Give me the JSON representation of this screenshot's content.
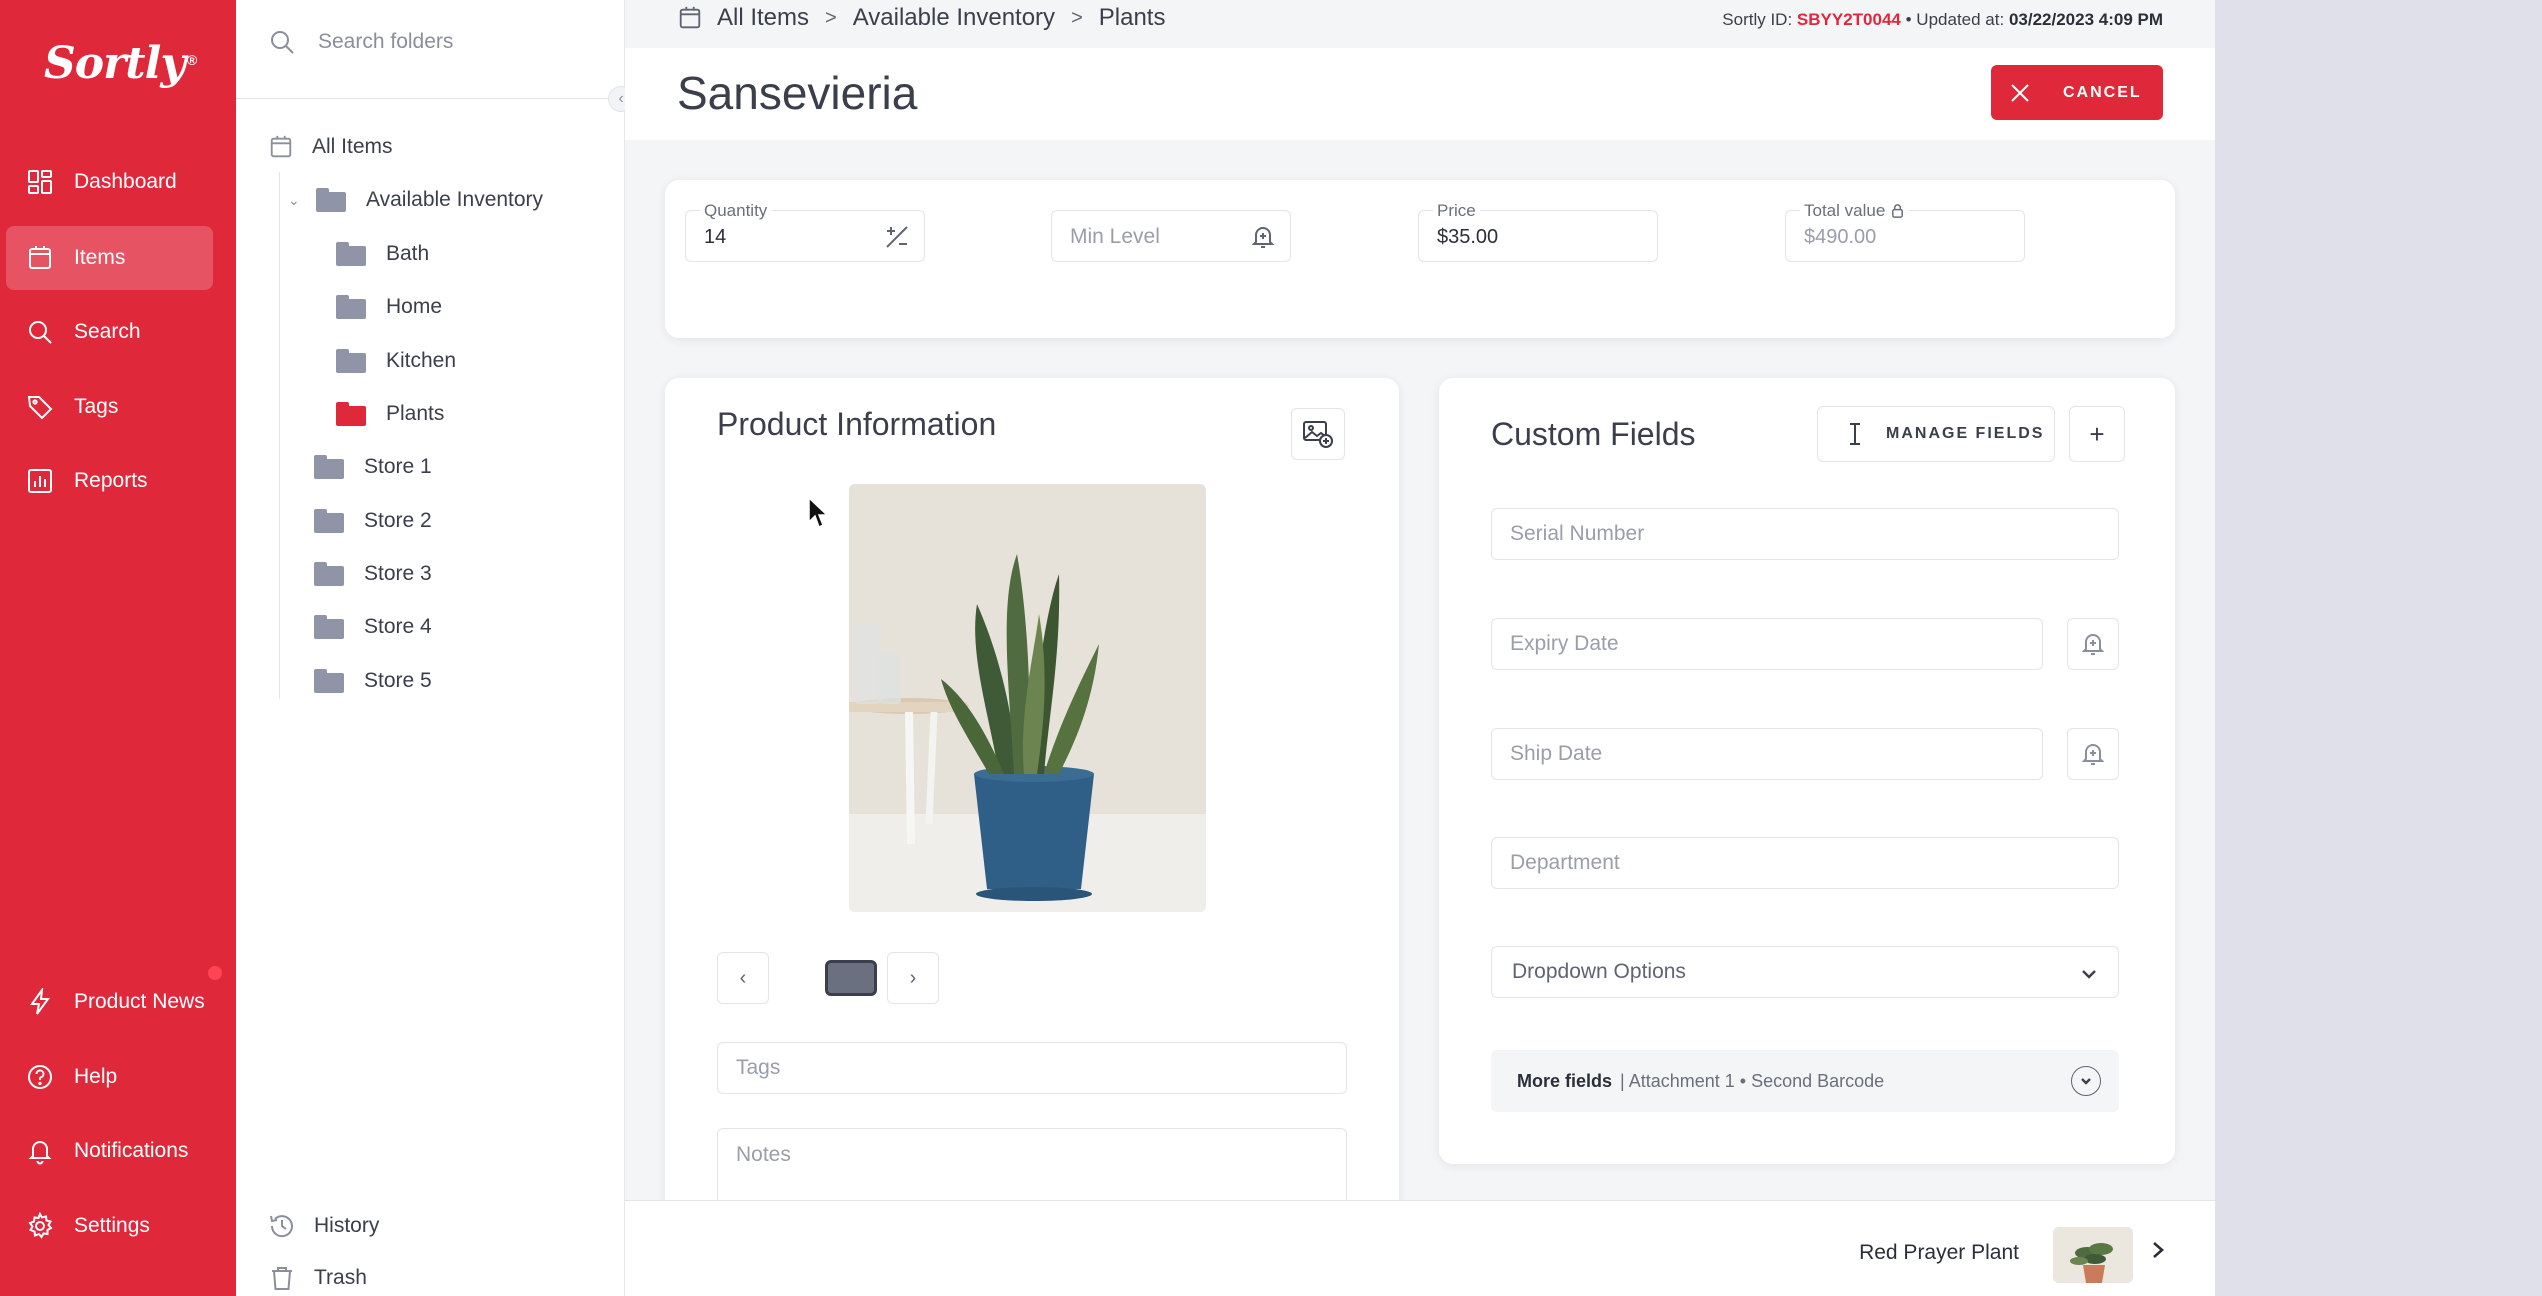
{
  "app": {
    "logo": "Sortly",
    "logo_mark": "®"
  },
  "nav": {
    "items": [
      {
        "label": "Dashboard",
        "icon": "dashboard-icon"
      },
      {
        "label": "Items",
        "icon": "items-icon",
        "active": true
      },
      {
        "label": "Search",
        "icon": "search-icon"
      },
      {
        "label": "Tags",
        "icon": "tag-icon"
      },
      {
        "label": "Reports",
        "icon": "reports-icon"
      }
    ],
    "bottom": [
      {
        "label": "Product News",
        "icon": "lightning-icon"
      },
      {
        "label": "Help",
        "icon": "help-icon"
      },
      {
        "label": "Notifications",
        "icon": "bell-icon"
      },
      {
        "label": "Settings",
        "icon": "gear-icon"
      }
    ]
  },
  "folders": {
    "search_placeholder": "Search folders",
    "all_items": "All Items",
    "available_inventory": "Available Inventory",
    "sub": [
      "Bath",
      "Home",
      "Kitchen",
      "Plants"
    ],
    "stores": [
      "Store 1",
      "Store 2",
      "Store 3",
      "Store 4",
      "Store 5"
    ],
    "history": "History",
    "trash": "Trash"
  },
  "breadcrumb": {
    "root": "All Items",
    "parent": "Available Inventory",
    "current": "Plants"
  },
  "meta": {
    "id_label": "Sortly ID:",
    "id": "SBYY2T0044",
    "separator": "•",
    "updated_label": "Updated at:",
    "updated": "03/22/2023 4:09 PM"
  },
  "item": {
    "title": "Sansevieria"
  },
  "cancel_label": "CANCEL",
  "fields": {
    "quantity_label": "Quantity",
    "quantity": "14",
    "min_level_placeholder": "Min Level",
    "price_label": "Price",
    "price": "$35.00",
    "total_label": "Total value",
    "total": "$490.00"
  },
  "product_info": {
    "title": "Product Information",
    "tags_placeholder": "Tags",
    "notes_placeholder": "Notes",
    "prev": "‹",
    "next": "›"
  },
  "custom_fields": {
    "title": "Custom Fields",
    "manage_label": "MANAGE FIELDS",
    "add_label": "+",
    "serial": "Serial Number",
    "expiry": "Expiry Date",
    "ship": "Ship Date",
    "department": "Department",
    "dropdown": "Dropdown Options",
    "more_label": "More fields",
    "more_detail": "| Attachment 1 • Second Barcode"
  },
  "next_item": {
    "name": "Red Prayer Plant"
  },
  "colors": {
    "brand": "#e0283b",
    "background": "#f4f5f7",
    "text": "#3b3f4b"
  }
}
